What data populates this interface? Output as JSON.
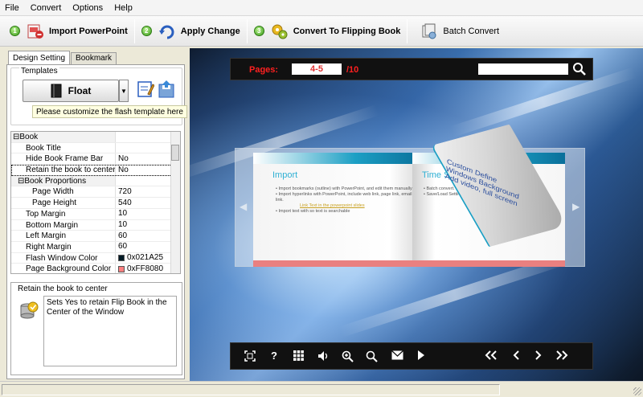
{
  "menu": [
    "File",
    "Convert",
    "Options",
    "Help"
  ],
  "toolbar": {
    "import_label": "Import PowerPoint",
    "apply_label": "Apply Change",
    "convert_label": "Convert To Flipping Book",
    "batch_label": "Batch Convert",
    "step1": "1",
    "step2": "2",
    "step3": "3"
  },
  "tabs": {
    "design": "Design Setting",
    "bookmark": "Bookmark"
  },
  "templates": {
    "label": "Templates",
    "selected": "Float",
    "customize_hint": "Please customize the flash template here"
  },
  "properties": [
    {
      "name": "Book",
      "value": "",
      "level": 0,
      "category": true,
      "expander": "⊟"
    },
    {
      "name": "Book Title",
      "value": "",
      "level": 1
    },
    {
      "name": "Hide Book Frame Bar",
      "value": "No",
      "level": 1
    },
    {
      "name": "Retain the book to center",
      "value": "No",
      "level": 1,
      "selected": true
    },
    {
      "name": "Book Proportions",
      "value": "",
      "level": 1,
      "category": true,
      "expander": "⊟"
    },
    {
      "name": "Page Width",
      "value": "720",
      "level": 2
    },
    {
      "name": "Page Height",
      "value": "540",
      "level": 2
    },
    {
      "name": "Top Margin",
      "value": "10",
      "level": 1
    },
    {
      "name": "Bottom Margin",
      "value": "10",
      "level": 1
    },
    {
      "name": "Left Margin",
      "value": "60",
      "level": 1
    },
    {
      "name": "Right Margin",
      "value": "60",
      "level": 1
    },
    {
      "name": "Flash Window Color",
      "value": "0x021A25",
      "level": 1,
      "swatch": "#021A25"
    },
    {
      "name": "Page Background Color",
      "value": "0xFF8080",
      "level": 1,
      "swatch": "#FF8080"
    }
  ],
  "description": {
    "title": "Retain the book to center",
    "text": "Sets Yes to retain Flip Book in the Center of the Window"
  },
  "viewer": {
    "pages_label": "Pages:",
    "current_pages": "4-5",
    "total_pages": "/10",
    "search_value": "",
    "left_page": {
      "heading": "Import",
      "bullets": [
        "Import bookmarks (outline) with PowerPoint, and edit them manually.",
        "Import hyperlinks with PowerPoint, include web link, page link, email link.",
        "Link Text in the powerpoint slides",
        "Import text with so text is searchable"
      ]
    },
    "right_page": {
      "heading": "Time Saving",
      "bullets": [
        "Batch convert.",
        "Save/Load Settings."
      ]
    },
    "curl_text": "Custom Define Windows Background Add video, full screen",
    "nav_left": "◀",
    "nav_right": "▶"
  },
  "bottom_icons": [
    "fullscreen-icon",
    "help-icon",
    "thumbnails-icon",
    "sound-icon",
    "zoom-in-icon",
    "search-icon",
    "email-icon",
    "autoplay-icon",
    "first-page-icon",
    "prev-page-icon",
    "next-page-icon",
    "last-page-icon"
  ],
  "colors": {
    "accent_red": "#ff2020",
    "page_head_blue": "#1c9fc4",
    "page_foot_pink": "#e98080"
  }
}
